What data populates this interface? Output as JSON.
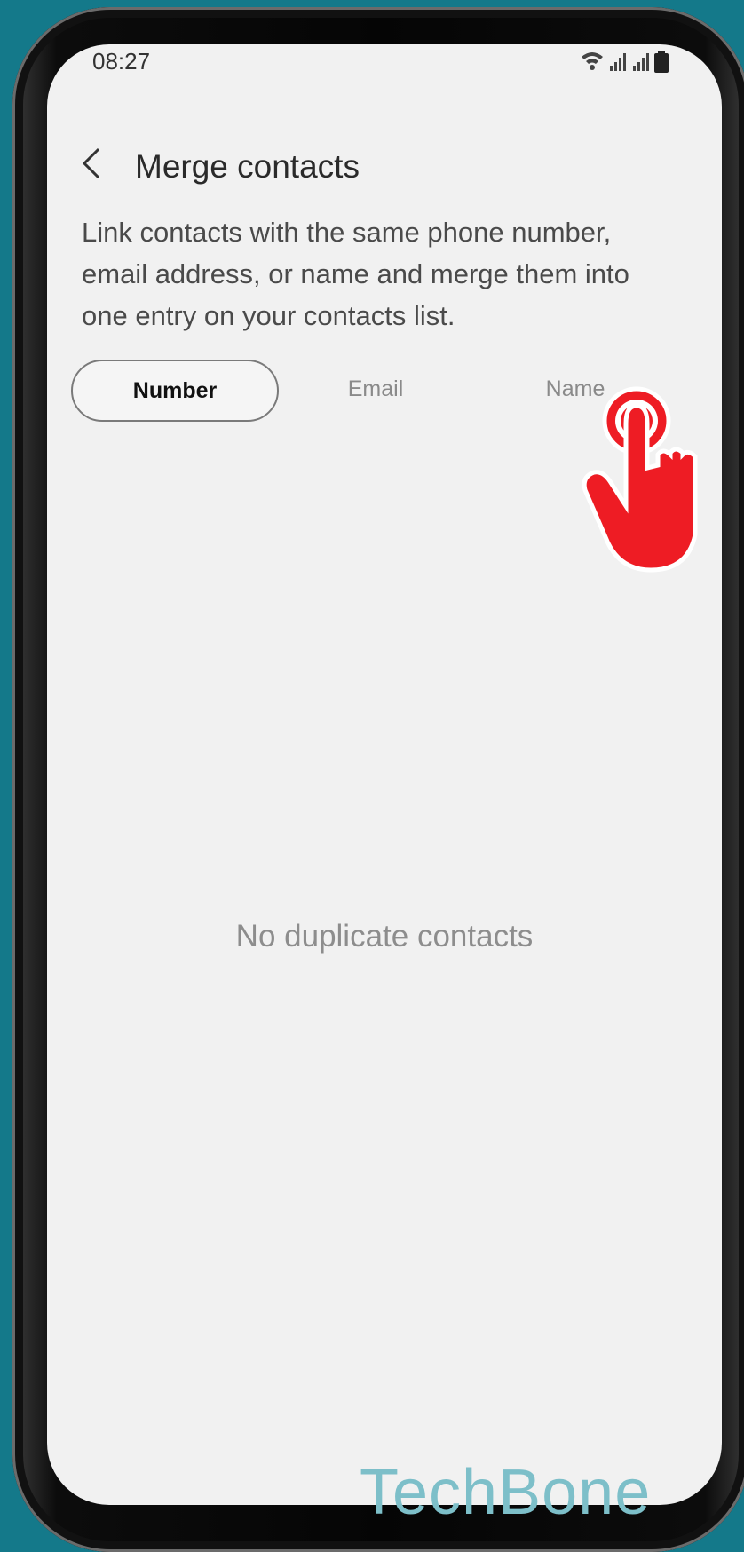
{
  "status_bar": {
    "time": "08:27",
    "icons": [
      "wifi-icon",
      "signal-icon",
      "signal-icon",
      "battery-icon"
    ]
  },
  "header": {
    "back_icon": "back-arrow-icon",
    "title": "Merge contacts"
  },
  "description": "Link contacts with the same phone number, email address, or name and merge them into one entry on your contacts list.",
  "tabs": [
    {
      "label": "Number",
      "selected": true
    },
    {
      "label": "Email",
      "selected": false
    },
    {
      "label": "Name",
      "selected": false
    }
  ],
  "empty_state": "No duplicate contacts",
  "watermark": "TechBone",
  "colors": {
    "background": "#14798a",
    "screen": "#f1f1f1",
    "tap_indicator": "#ee1c24",
    "watermark": "#7dbfc9"
  }
}
